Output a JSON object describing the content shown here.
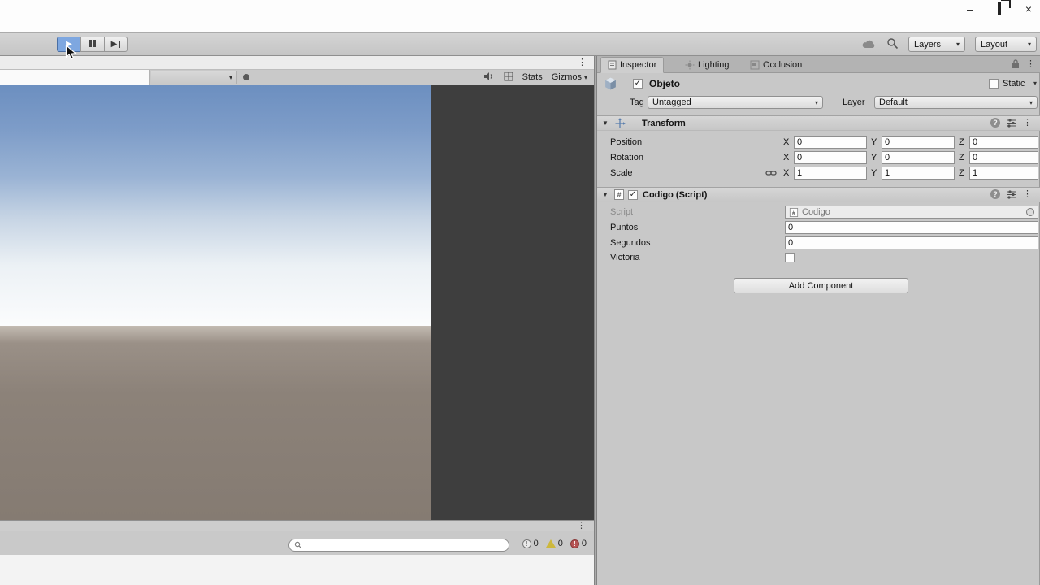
{
  "icons": {
    "play": "▶",
    "dropdown_arrow": "▾",
    "foldout_open": "▼",
    "kebab": "⋮",
    "check": "✓",
    "help": "?",
    "hash": "#",
    "bang": "!",
    "minimize": "–",
    "close": "×"
  },
  "toolbar": {
    "layers_label": "Layers",
    "layout_label": "Layout"
  },
  "game_view": {
    "aspect_value": "",
    "stats_label": "Stats",
    "gizmos_label": "Gizmos"
  },
  "console": {
    "search_value": "",
    "counts": [
      {
        "type": "info",
        "value": "0"
      },
      {
        "type": "warning",
        "value": "0"
      },
      {
        "type": "error",
        "value": "0"
      }
    ]
  },
  "inspector": {
    "tabs": [
      {
        "label": "Inspector"
      },
      {
        "label": "Lighting"
      },
      {
        "label": "Occlusion"
      }
    ],
    "header": {
      "name": "Objeto",
      "static_label": "Static"
    },
    "tag_label": "Tag",
    "tag_value": "Untagged",
    "layer_label": "Layer",
    "layer_value": "Default",
    "transform": {
      "title": "Transform",
      "axis_x": "X",
      "axis_y": "Y",
      "axis_z": "Z",
      "rows": [
        {
          "label": "Position",
          "x": "0",
          "y": "0",
          "z": "0"
        },
        {
          "label": "Rotation",
          "x": "0",
          "y": "0",
          "z": "0"
        },
        {
          "label": "Scale",
          "x": "1",
          "y": "1",
          "z": "1"
        }
      ]
    },
    "script": {
      "title": "Codigo (Script)",
      "script_label": "Script",
      "script_value": "Codigo",
      "puntos_label": "Puntos",
      "puntos_value": "0",
      "segundos_label": "Segundos",
      "segundos_value": "0",
      "victoria_label": "Victoria"
    },
    "add_component_label": "Add Component"
  },
  "colors": {
    "panel_gray": "#c8c8c8",
    "letterbox_gray": "#3e3e3e",
    "play_active_blue": "#7ea7e0",
    "sky_blue": "#6c8fc0",
    "ground_brown": "#8c8279"
  }
}
